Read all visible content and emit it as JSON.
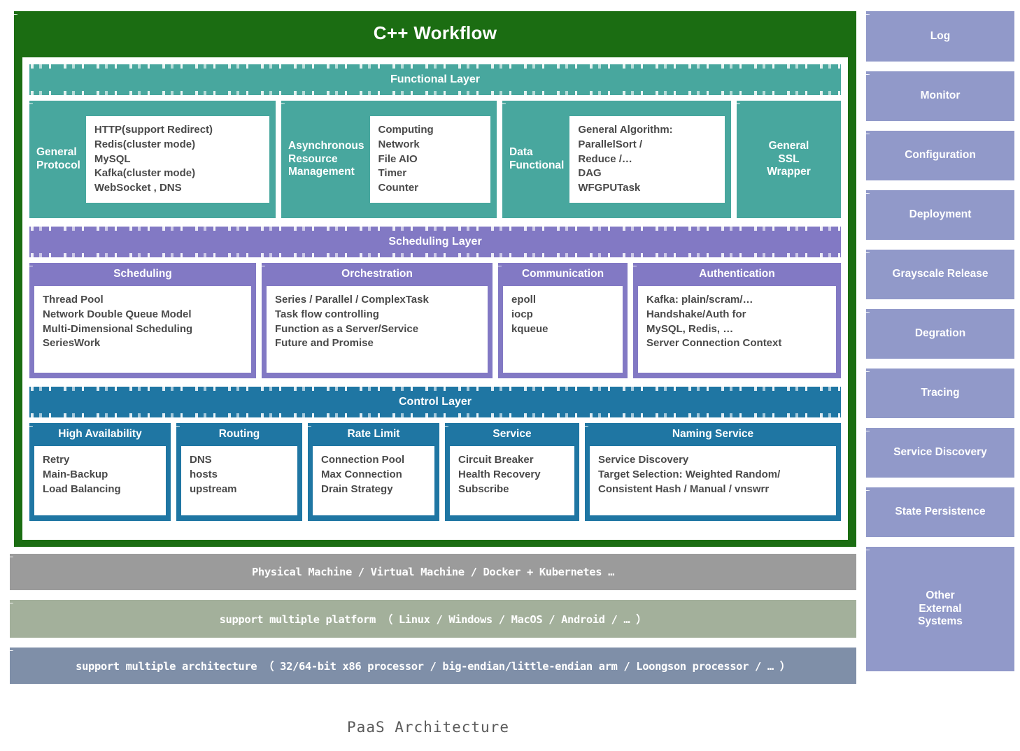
{
  "title": "C++ Workflow",
  "caption": "PaaS Architecture",
  "colors": {
    "frame_green": "#1b6d12",
    "functional_teal": "#48a79e",
    "scheduling_purple": "#8279c4",
    "control_blue": "#1f76a3",
    "sidebar_purple": "#9199c9",
    "machine_gray": "#9b9b9b",
    "platform_green": "#a3b09b",
    "arch_blue_gray": "#7f8fa8",
    "body_text": "#4a4a4a"
  },
  "layers": [
    {
      "name": "functional",
      "header": "Functional Layer",
      "cards": [
        {
          "title": "General\nProtocol",
          "layout": "side",
          "body": "HTTP(support Redirect)\nRedis(cluster mode)\nMySQL\nKafka(cluster mode)\nWebSocket ,  DNS"
        },
        {
          "title": "Asynchronous\nResource\nManagement",
          "layout": "side",
          "body": "Computing\nNetwork\nFile AIO\nTimer\nCounter"
        },
        {
          "title": "Data\nFunctional",
          "layout": "side",
          "body": "General Algorithm:\nParallelSort /\nReduce /…\nDAG\nWFGPUTask"
        },
        {
          "title": "General\nSSL\nWrapper",
          "layout": "solo",
          "body": ""
        }
      ]
    },
    {
      "name": "scheduling",
      "header": "Scheduling Layer",
      "cards": [
        {
          "title": "Scheduling",
          "layout": "top",
          "body": "Thread Pool\nNetwork Double Queue Model\nMulti-Dimensional Scheduling\nSeriesWork"
        },
        {
          "title": "Orchestration",
          "layout": "top",
          "body": "Series / Parallel / ComplexTask\nTask flow controlling\nFunction as a Server/Service\nFuture and Promise"
        },
        {
          "title": "Communication",
          "layout": "top",
          "body": "epoll\niocp\nkqueue"
        },
        {
          "title": "Authentication",
          "layout": "top",
          "body": "Kafka: plain/scram/…\nHandshake/Auth for\nMySQL, Redis, …\nServer Connection Context"
        }
      ]
    },
    {
      "name": "control",
      "header": "Control Layer",
      "cards": [
        {
          "title": "High Availability",
          "layout": "top",
          "body": "Retry\nMain-Backup\nLoad Balancing"
        },
        {
          "title": "Routing",
          "layout": "top",
          "body": "DNS\nhosts\nupstream"
        },
        {
          "title": "Rate Limit",
          "layout": "top",
          "body": "Connection Pool\nMax Connection\nDrain Strategy"
        },
        {
          "title": "Service",
          "layout": "top",
          "body": "Circuit Breaker\nHealth Recovery\nSubscribe"
        },
        {
          "title": "Naming Service",
          "layout": "top",
          "body": "Service Discovery\nTarget Selection: Weighted Random/\nConsistent Hash / Manual / vnswrr"
        }
      ]
    }
  ],
  "infrastructure": {
    "machine": "Physical Machine    /    Virtual Machine    /    Docker + Kubernetes …",
    "platform": "support multiple platform （ Linux  /  Windows  /  MacOS /  Android /  … ）",
    "architecture": "support multiple architecture  （ 32/64-bit x86 processor  /  big-endian/little-endian arm  /  Loongson processor  /  … ）"
  },
  "sidebar": {
    "items": [
      {
        "label": "Log"
      },
      {
        "label": "Monitor"
      },
      {
        "label": "Configuration"
      },
      {
        "label": "Deployment"
      },
      {
        "label": "Grayscale Release"
      },
      {
        "label": "Degration"
      },
      {
        "label": "Tracing"
      },
      {
        "label": "Service Discovery"
      },
      {
        "label": "State Persistence"
      },
      {
        "label": "Other\nExternal\nSystems"
      }
    ]
  }
}
